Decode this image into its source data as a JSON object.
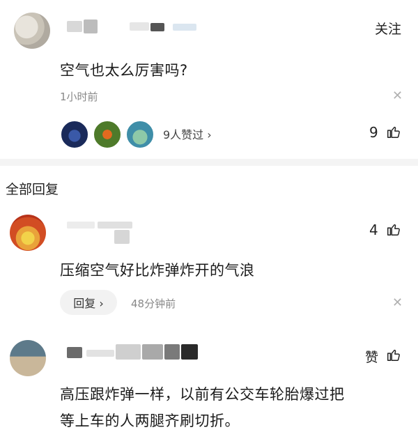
{
  "post": {
    "follow_label": "关注",
    "comment_text": "空气也太么厉害吗?",
    "time": "1小时前",
    "likers_label": "9人赞过 ›",
    "like_count": "9"
  },
  "replies_header": "全部回复",
  "replies": [
    {
      "text": "压缩空气好比炸弹炸开的气浪",
      "like_count": "4",
      "reply_button": "回复 ›",
      "time": "48分钟前"
    },
    {
      "text_line1": "高压跟炸弹一样，以前有公交车轮胎爆过把",
      "text_line2": "等上车的人两腿齐刷切折。",
      "like_label": "赞"
    }
  ],
  "icons": {
    "close": "close-icon",
    "thumb": "thumb-up-icon"
  }
}
